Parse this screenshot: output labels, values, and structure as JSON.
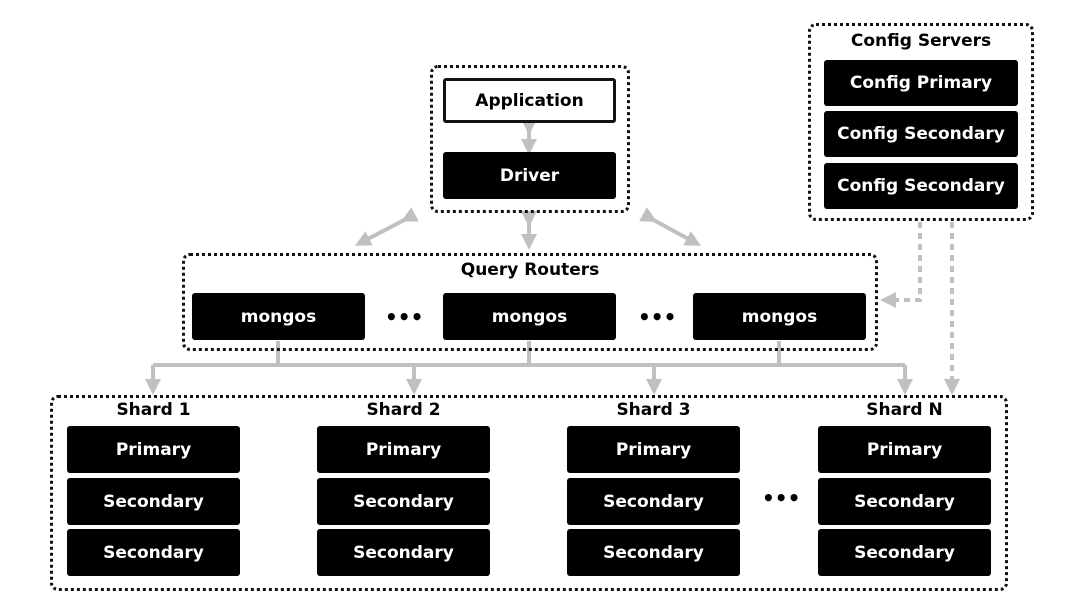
{
  "client": {
    "application": "Application",
    "driver": "Driver"
  },
  "config_servers": {
    "title": "Config Servers",
    "members": [
      "Config Primary",
      "Config Secondary",
      "Config Secondary"
    ]
  },
  "query_routers": {
    "title": "Query Routers",
    "routers": [
      "mongos",
      "mongos",
      "mongos"
    ],
    "ellipsis": "•••"
  },
  "shards": [
    {
      "title": "Shard 1",
      "members": [
        "Primary",
        "Secondary",
        "Secondary"
      ]
    },
    {
      "title": "Shard 2",
      "members": [
        "Primary",
        "Secondary",
        "Secondary"
      ]
    },
    {
      "title": "Shard 3",
      "members": [
        "Primary",
        "Secondary",
        "Secondary"
      ]
    },
    {
      "title": "Shard N",
      "members": [
        "Primary",
        "Secondary",
        "Secondary"
      ]
    }
  ],
  "shard_ellipsis": "•••",
  "colors": {
    "node": "#000000",
    "arrow": "#c0c0c0",
    "border": "#111111"
  }
}
